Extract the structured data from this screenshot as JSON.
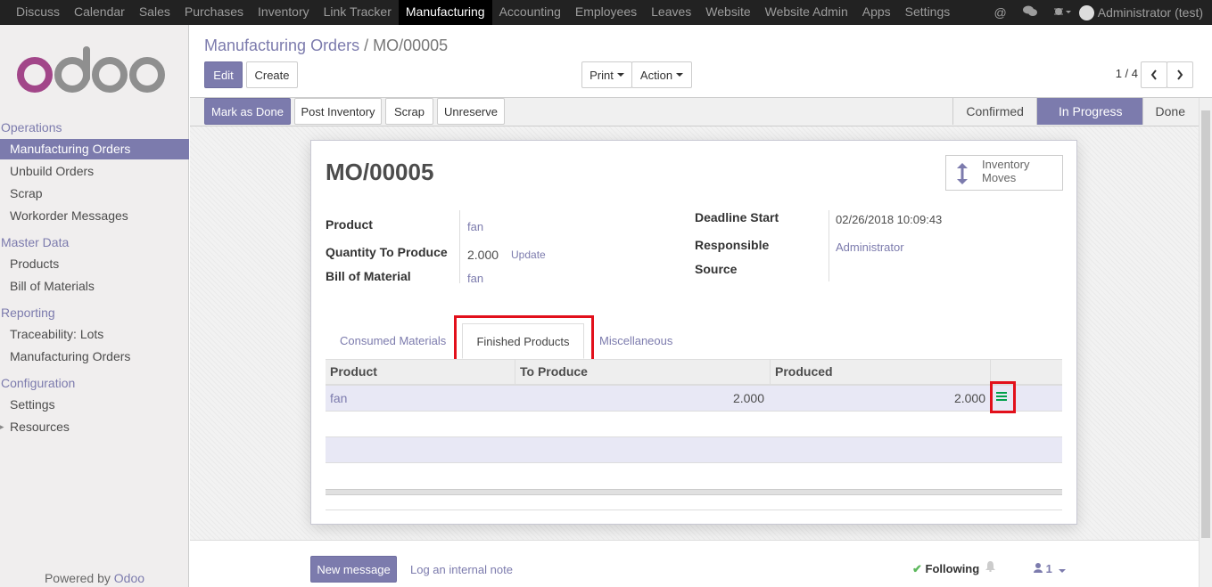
{
  "topbar": {
    "menu": [
      "Discuss",
      "Calendar",
      "Sales",
      "Purchases",
      "Inventory",
      "Link Tracker",
      "Manufacturing",
      "Accounting",
      "Employees",
      "Leaves",
      "Website",
      "Website Admin",
      "Apps",
      "Settings"
    ],
    "active_menu": "Manufacturing",
    "user": "Administrator (test)",
    "icons": [
      "at-icon",
      "chat-icon",
      "bug-icon"
    ]
  },
  "sidebar": {
    "sections": [
      {
        "title": "Operations",
        "items": [
          "Manufacturing Orders",
          "Unbuild Orders",
          "Scrap",
          "Workorder Messages"
        ]
      },
      {
        "title": "Master Data",
        "items": [
          "Products",
          "Bill of Materials"
        ]
      },
      {
        "title": "Reporting",
        "items": [
          "Traceability: Lots",
          "Manufacturing Orders"
        ]
      },
      {
        "title": "Configuration",
        "items": [
          "Settings",
          "Resources"
        ]
      }
    ],
    "active_item": "Manufacturing Orders",
    "powered_prefix": "Powered by",
    "powered_brand": "Odoo"
  },
  "control_panel": {
    "breadcrumb_parent": "Manufacturing Orders",
    "breadcrumb_sep": "/",
    "breadcrumb_current": "MO/00005",
    "edit": "Edit",
    "create": "Create",
    "print": "Print",
    "action": "Action",
    "pager": "1 / 4"
  },
  "statusbar": {
    "buttons": [
      "Mark as Done",
      "Post Inventory",
      "Scrap",
      "Unreserve"
    ],
    "stages": [
      "Confirmed",
      "In Progress",
      "Done"
    ],
    "current_stage": "In Progress"
  },
  "form": {
    "title": "MO/00005",
    "smart_button": {
      "line1": "Inventory",
      "line2": "Moves"
    },
    "fields_left": [
      {
        "label": "Product",
        "value": "fan"
      },
      {
        "label": "Quantity To Produce",
        "value": "2.000",
        "action": "Update"
      },
      {
        "label": "Bill of Material",
        "value": "fan"
      }
    ],
    "fields_right": [
      {
        "label": "Deadline Start",
        "value": "02/26/2018 10:09:43"
      },
      {
        "label": "Responsible",
        "value": "Administrator"
      },
      {
        "label": "Source",
        "value": ""
      }
    ],
    "tabs": [
      "Consumed Materials",
      "Finished Products",
      "Miscellaneous"
    ],
    "active_tab": "Finished Products",
    "table": {
      "columns": [
        "Product",
        "To Produce",
        "Produced"
      ],
      "rows": [
        {
          "product": "fan",
          "to_produce": "2.000",
          "produced": "2.000"
        }
      ]
    }
  },
  "chatter": {
    "new_message": "New message",
    "log_note": "Log an internal note",
    "following": "Following",
    "followers": "1"
  },
  "colors": {
    "brand": "#7c7bad",
    "highlight": "#e2101b",
    "topbar": "#222222"
  }
}
